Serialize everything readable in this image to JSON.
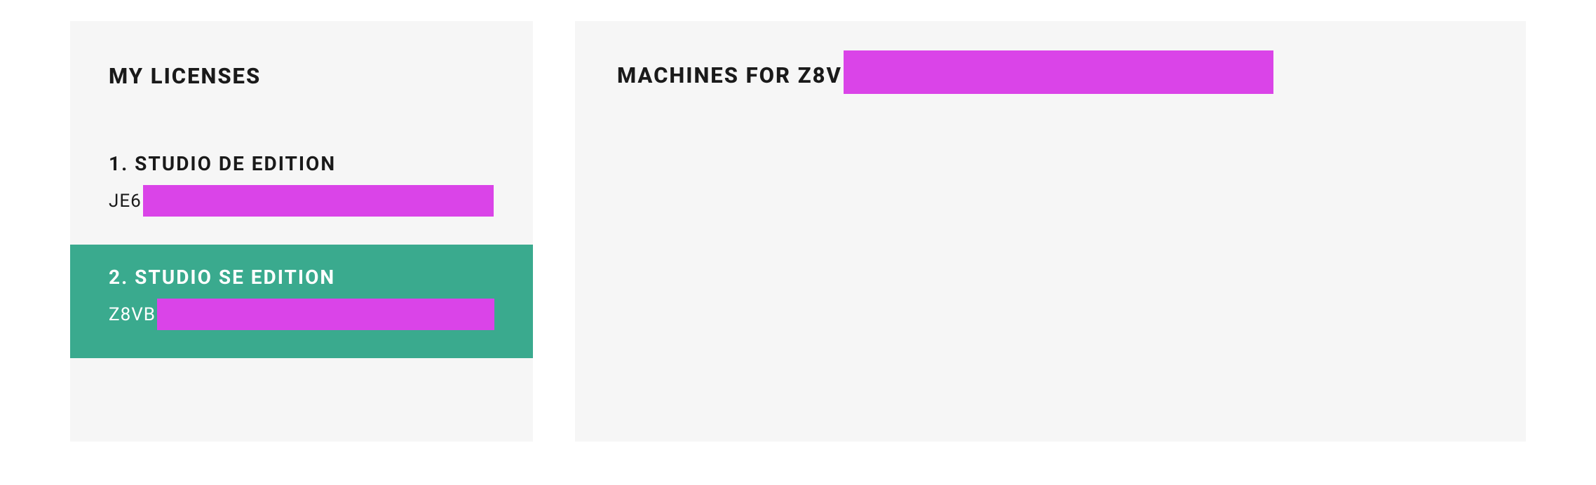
{
  "licenses": {
    "title": "MY LICENSES",
    "items": [
      {
        "title": "1. STUDIO DE EDITION",
        "key_prefix": "JE6"
      },
      {
        "title": "2. STUDIO SE EDITION",
        "key_prefix": "Z8VB"
      }
    ]
  },
  "machines": {
    "title_prefix": "MACHINES FOR Z8V"
  }
}
